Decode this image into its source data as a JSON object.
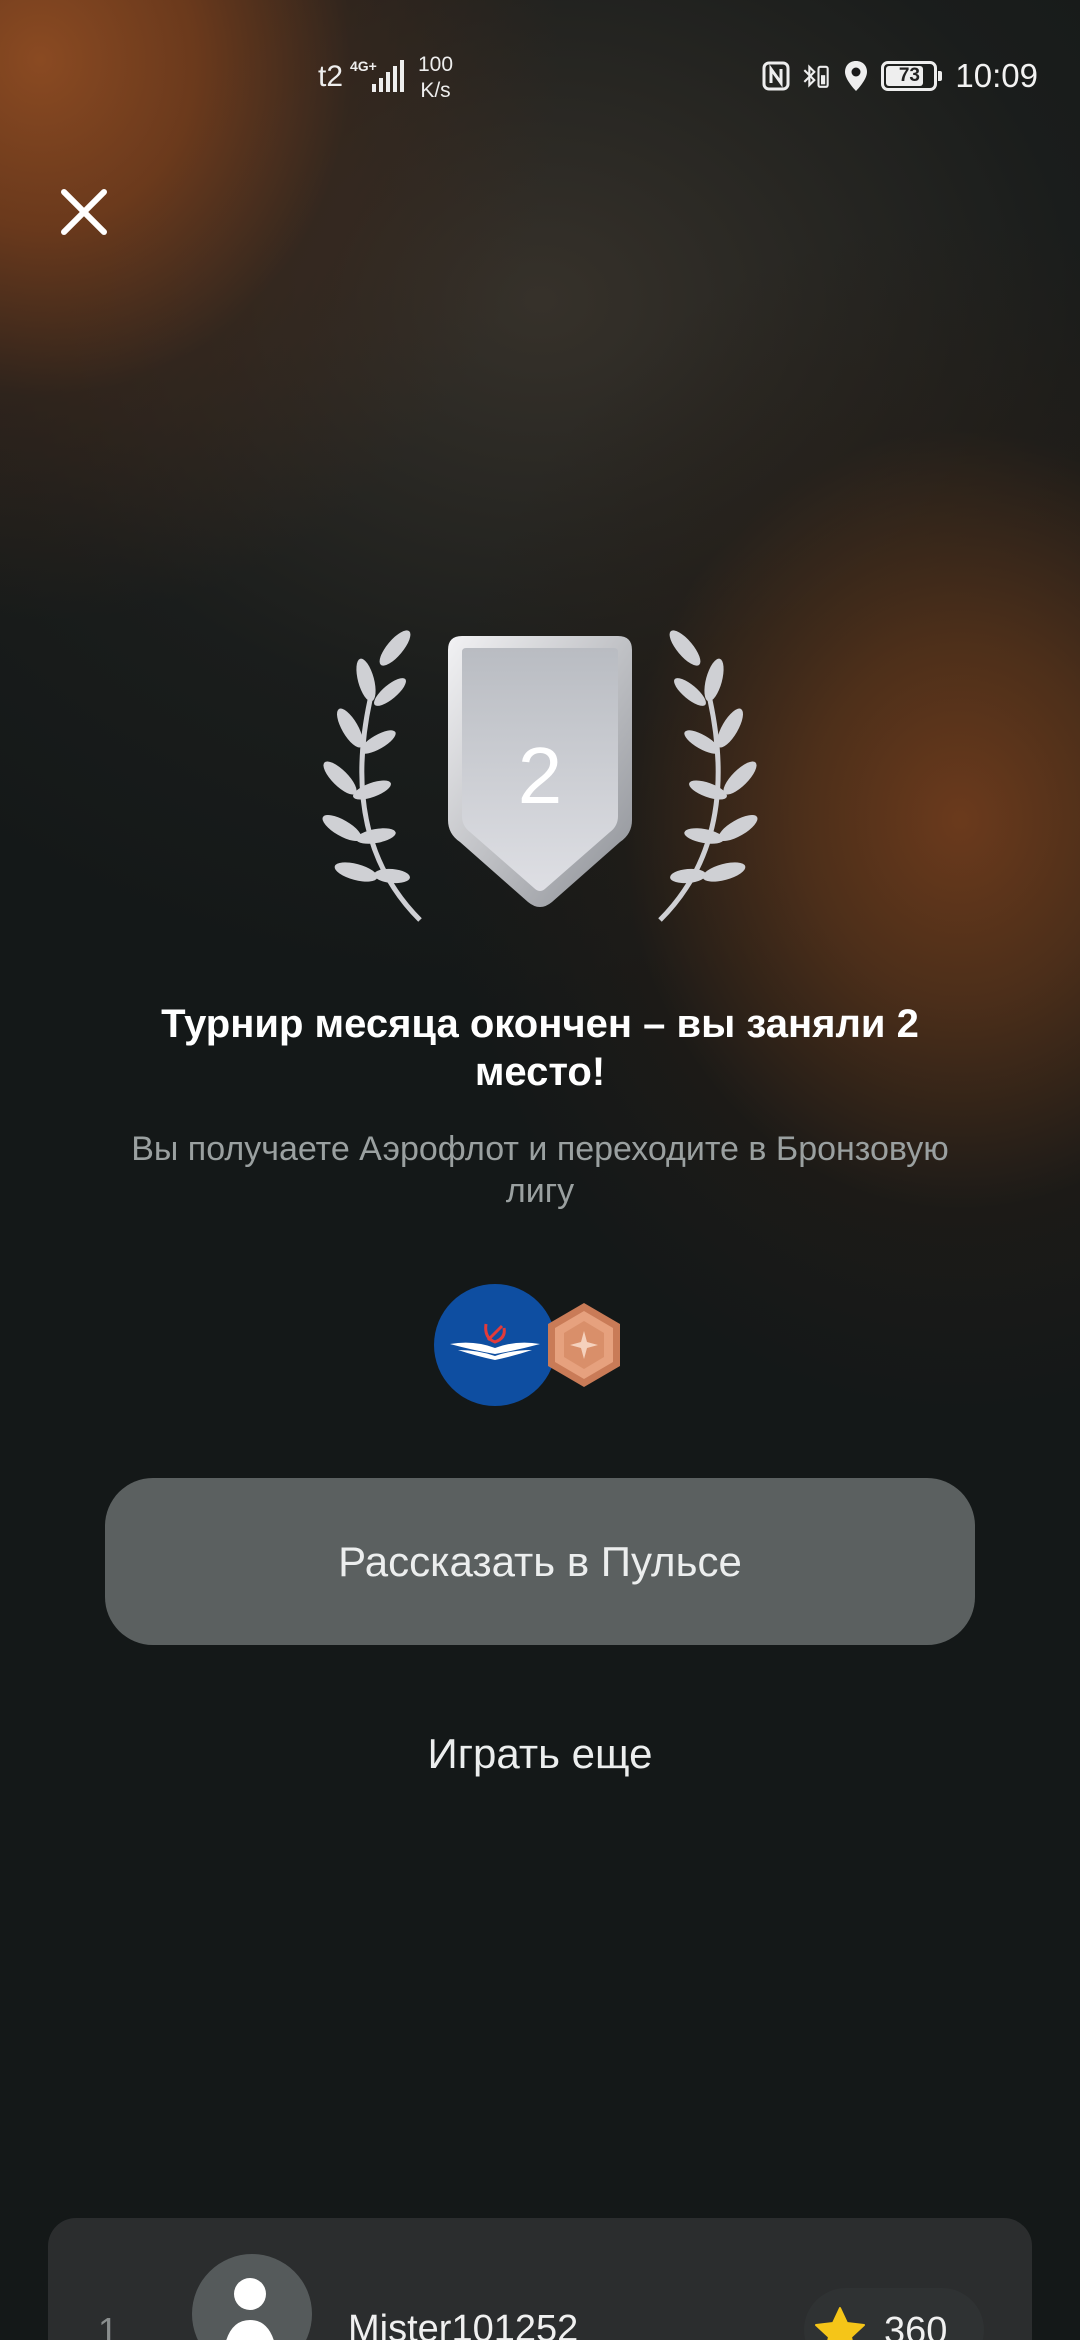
{
  "status_bar": {
    "carrier": "t2",
    "network": "4G+",
    "speed_value": "100",
    "speed_unit": "K/s",
    "battery": "73",
    "time": "10:09"
  },
  "icons": {
    "close": "close-icon",
    "nfc": "nfc-icon",
    "bluetooth": "bluetooth-battery-icon",
    "location": "location-icon",
    "star": "star-icon"
  },
  "badge": {
    "place": "2"
  },
  "result": {
    "title": "Турнир месяца окончен – вы заняли 2 место!",
    "subtitle": "Вы получаете Аэрофлот и переходите в Бронзовую лигу"
  },
  "actions": {
    "share_label": "Рассказать в Пульсе",
    "play_again_label": "Играть еще"
  },
  "leaderboard": {
    "rows": [
      {
        "rank": "1",
        "name": "Mister101252",
        "score": "360"
      }
    ]
  },
  "colors": {
    "aeroflot_blue": "#0e4ea1",
    "bronze": "#d98f6a",
    "share_button": "#5b6060",
    "star": "#f5c518"
  }
}
